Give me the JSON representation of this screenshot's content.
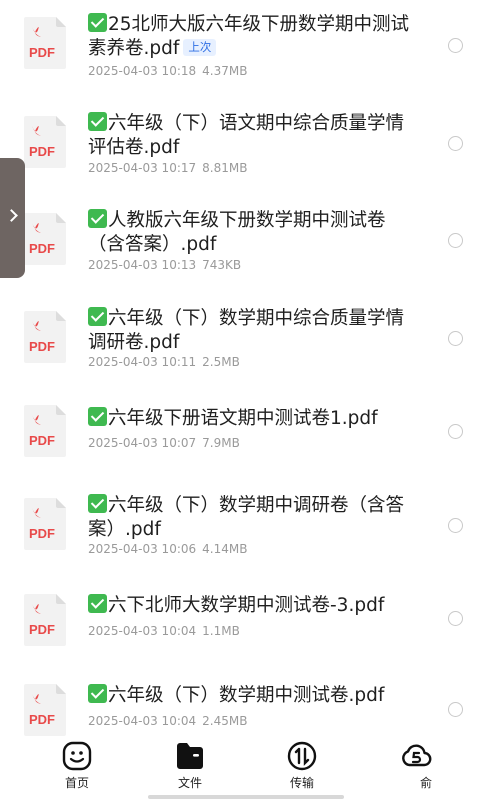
{
  "files": [
    {
      "title": "25北师大版六年级下册数学期中测试素养卷.pdf",
      "badge": "上次",
      "date": "2025-04-03 10:18",
      "size": "4.37MB",
      "icon": "pdf-icon"
    },
    {
      "title": "六年级（下）语文期中综合质量学情评估卷.pdf",
      "badge": "",
      "date": "2025-04-03 10:17",
      "size": "8.81MB",
      "icon": "pdf-icon"
    },
    {
      "title": "人教版六年级下册数学期中测试卷（含答案）.pdf",
      "badge": "",
      "date": "2025-04-03 10:13",
      "size": "743KB",
      "icon": "pdf-icon"
    },
    {
      "title": "六年级（下）数学期中综合质量学情调研卷.pdf",
      "badge": "",
      "date": "2025-04-03 10:11",
      "size": "2.5MB",
      "icon": "pdf-icon"
    },
    {
      "title": "六年级下册语文期中测试卷1.pdf",
      "badge": "",
      "date": "2025-04-03 10:07",
      "size": "7.9MB",
      "icon": "pdf-icon"
    },
    {
      "title": "六年级（下）数学期中调研卷（含答案）.pdf",
      "badge": "",
      "date": "2025-04-03 10:06",
      "size": "4.14MB",
      "icon": "pdf-icon"
    },
    {
      "title": "六下北师大数学期中测试卷-3.pdf",
      "badge": "",
      "date": "2025-04-03 10:04",
      "size": "1.1MB",
      "icon": "pdf-icon"
    },
    {
      "title": "六年级（下）数学期中测试卷.pdf",
      "badge": "",
      "date": "2025-04-03 10:04",
      "size": "2.45MB",
      "icon": "pdf-icon"
    }
  ],
  "pdf_icon_label": "PDF",
  "tabs": [
    {
      "label": "首页",
      "icon": "smiley-icon"
    },
    {
      "label": "文件",
      "icon": "folder-icon"
    },
    {
      "label": "传输",
      "icon": "transfer-icon"
    },
    {
      "label": "俞",
      "icon": "cloud-icon"
    }
  ],
  "colors": {
    "pdf_red": "#e84a4a",
    "check_green": "#3fb950",
    "badge_blue": "#2f6fe4"
  }
}
